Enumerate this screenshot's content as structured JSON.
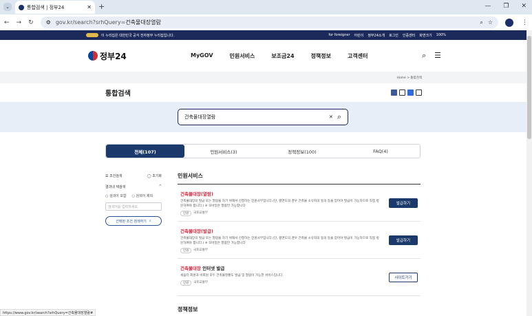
{
  "browser": {
    "tab_title": "통합검색 | 정부24",
    "url_prefix": "gov.kr/search?srhQuery=",
    "url_query": "건축물대장열람",
    "status_url": "https://www.gov.kr/search?srhQuery=건축물대장열람#"
  },
  "govbar": {
    "notice": "이 누리집은 대한민국 공식 전자정부 누리집입니다.",
    "links": [
      "for foreigner",
      "어린이",
      "정부24소개",
      "로그인",
      "인증센터",
      "화면크기",
      "100%"
    ]
  },
  "header": {
    "logo_text": "정부24",
    "nav": [
      "MyGOV",
      "민원서비스",
      "보조금24",
      "정책정보",
      "고객센터"
    ]
  },
  "breadcrumb": "Home > 통합검색",
  "page_title": "통합검색",
  "search": {
    "value": "건축물대장열람"
  },
  "tabs": [
    "전체(107)",
    "민원서비스(3)",
    "정책정보(100)",
    "FAQ(4)"
  ],
  "sidebar": {
    "filter_title": "조건검색",
    "reset": "초기화",
    "subtitle": "결과내 재검색",
    "include": "검색어 포함",
    "exclude": "검색어 제외",
    "placeholder": "검색어를 입력하세요.",
    "apply_button": "선택된 조건 검색하기"
  },
  "main": {
    "section_title": "민원서비스",
    "items": [
      {
        "highlight": "건축물대장(열람)",
        "rest": "",
        "desc": "건축물대장의 발급 또는 열람을 하기 위해서 신청하는 민원사무입니다.(단, 평면도의 경우 건축물 소유자의 동의 등을 얻어야 발급이 가능하므로 직접 방문하여야 합니다.) ※ 모바일은 열람만 가능합니다",
        "tag": "민원",
        "org": "국토교통부",
        "action": "발급하기"
      },
      {
        "highlight": "건축물대장(발급)",
        "rest": "",
        "desc": "건축물대장의 발급 또는 열람을 하기 위해서 신청하는 민원사무입니다.(단, 평면도의 경우 건축물 소유자의 동의 등을 얻어야 발급이 가능하므로 직접 방문하여야 합니다.) ※ 모바일은 열람만 가능합니다",
        "tag": "민원",
        "org": "국토교통부",
        "action": "발급하기"
      },
      {
        "highlight": "건축물대장",
        "rest": " 인터넷 발급",
        "desc": "세움터 회원과 비회원 모두 건축물현황도 발급 및 열람이 가능한 서비스입니다.",
        "tag": "민원",
        "org": "국토교통부",
        "action": "사이트가기"
      }
    ],
    "section2_title": "정책정보"
  }
}
